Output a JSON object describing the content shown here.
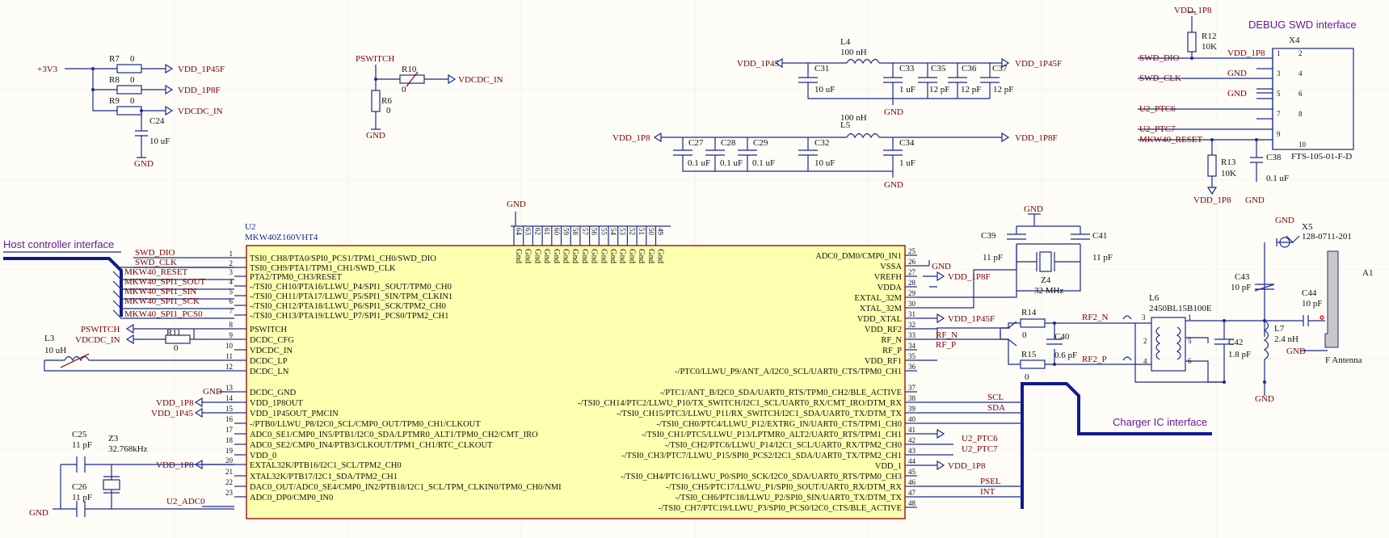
{
  "sections": {
    "host": "Host controller interface",
    "debug": "DEBUG SWD interface",
    "charger": "Charger IC interface"
  },
  "power": {
    "p3v3": "+3V3",
    "vdd1p45f_a": "VDD_1P45F",
    "vdd1p8f_a": "VDD_1P8F",
    "vdcdcin_a": "VDCDC_IN",
    "vdcdcin_b": "VDCDC_IN",
    "vdd1p45_l4": "VDD_1P45",
    "vdd1p45f_l4": "VDD_1P45F",
    "vdd1p8_l5": "VDD_1P8",
    "vdd1p8f_l5": "VDD_1P8F",
    "vdd1p8_swd": "VDD_1P8",
    "vdd1p8_r13": "VDD_1P8",
    "vdd1p8f_vrefh": "VDD_1P8F",
    "vdd1p45f_xtal": "VDD_1P45F",
    "vdd1p8_p14": "VDD_1P8",
    "vdd1p45_p15": "VDD_1P45",
    "vdd1p8_p20": "VDD_1P8",
    "vdd1p8_p44": "VDD_1P8",
    "pswitch": "PSWITCH",
    "pswitch_out": "PSWITCH"
  },
  "gnd": [
    "GND",
    "GND",
    "GND",
    "GND",
    "GND",
    "GND",
    "GND",
    "GND",
    "GND",
    "GND",
    "GND",
    "GND",
    "GND",
    "GND",
    "GND",
    "GND"
  ],
  "components": {
    "r7": "R7",
    "r7v": "0",
    "r8": "R8",
    "r8v": "0",
    "r9": "R9",
    "r9v": "0",
    "c24": "C24",
    "c24v": "10 uF",
    "r10": "R10",
    "r10v": "0",
    "r6": "R6",
    "r6v": "0",
    "l4": "L4",
    "l4v": "100 nH",
    "l5": "L5",
    "l5v": "100 nH",
    "c31": "C31",
    "c31v": "10 uF",
    "c33": "C33",
    "c33v": "1 uF",
    "c35": "C35",
    "c35v": "12 pF",
    "c36": "C36",
    "c36v": "12 pF",
    "c37": "C37",
    "c37v": "12 pF",
    "c27": "C27",
    "c27v": "0.1 uF",
    "c28": "C28",
    "c28v": "0.1 uF",
    "c29": "C29",
    "c29v": "0.1 uF",
    "c32": "C32",
    "c32v": "10 uF",
    "c34": "C34",
    "c34v": "1 uF",
    "r12": "R12",
    "r12v": "10K",
    "r13": "R13",
    "r13v": "10K",
    "c38": "C38",
    "c38v": "0.1 uF",
    "x4": "X4",
    "x4part": "FTS-105-01-F-D",
    "u2": "U2",
    "u2part": "MKW40Z160VHT4",
    "c39": "C39",
    "c39v": "11 pF",
    "c41": "C41",
    "c41v": "11 pF",
    "z4": "Z4",
    "z4v": "32 MHz",
    "r14": "R14",
    "r14v": "0",
    "r15": "R15",
    "r15v": "0",
    "c40": "C40",
    "c40v": "0.6 pF",
    "l6": "L6",
    "l6v": "2450BL15B100E",
    "c42": "C42",
    "c42v": "1.8 pF",
    "l7": "L7",
    "l7v": "2.4 nH",
    "c43": "C43",
    "c43v": "10 pF",
    "c44": "C44",
    "c44v": "10 pF",
    "x5": "X5",
    "x5part": "128-0711-201",
    "a1": "A1",
    "a1v": "F Antenna",
    "l3": "L3",
    "l3v": "10 uH",
    "r11": "R11",
    "r11v": "0",
    "c25": "C25",
    "c25v": "11 pF",
    "c26": "C26",
    "c26v": "11 pF",
    "z3": "Z3",
    "z3v": "32.768kHz"
  },
  "nets": {
    "swd_dio": "SWD_DIO",
    "swd_clk": "SWD_CLK",
    "mkw_reset": "MKW40_RESET",
    "spi_sout": "MKW40_SPI1_SOUT",
    "spi_sin": "MKW40_SPI1_SIN",
    "spi_sck": "MKW40_SPI1_SCK",
    "spi_pcs0": "MKW40_SPI1_PCS0",
    "x4_swd_dio": "SWD_DIO",
    "x4_swd_clk": "SWD_CLK",
    "x4_ptc6": "U2_PTC6",
    "x4_ptc7": "U2_PTC7",
    "x4_reset": "MKW40_RESET",
    "rf_n": "RF_N",
    "rf_p": "RF_P",
    "rf2_n": "RF2_N",
    "rf2_p": "RF2_P",
    "scl": "SCL",
    "sda": "SDA",
    "u2_ptc6": "U2_PTC6",
    "u2_ptc7": "U2_PTC7",
    "psel": "PSEL",
    "int": "INT",
    "u2_adc0": "U2_ADC0",
    "x4_gnd3": "GND",
    "x4_gnd5": "GND",
    "x4_vdd": "VDD_1P8"
  },
  "x4_pins": [
    "1",
    "2",
    "3",
    "4",
    "5",
    "6",
    "7",
    "8",
    "9",
    "10"
  ],
  "l6_pins": [
    "1",
    "2",
    "3",
    "4",
    "5",
    "6"
  ],
  "u2_left": [
    {
      "n": "1",
      "t": "TSI0_CH8/PTA0/SPI0_PCS1/TPM1_CH0/SWD_DIO"
    },
    {
      "n": "2",
      "t": "TSI0_CH9/PTA1/TPM1_CH1/SWD_CLK"
    },
    {
      "n": "3",
      "t": "PTA2/TPM0_CH3/RESET"
    },
    {
      "n": "4",
      "t": "-/TSI0_CH10/PTA16/LLWU_P4/SPI1_SOUT/TPM0_CH0"
    },
    {
      "n": "5",
      "t": "-/TSI0_CH11/PTA17/LLWU_P5/SPI1_SIN/TPM_CLKIN1"
    },
    {
      "n": "6",
      "t": "-/TSI0_CH12/PTA18/LLWU_P6/SPI1_SCK/TPM2_CH0"
    },
    {
      "n": "7",
      "t": "-/TSI0_CH13/PTA19/LLWU_P7/SPI1_PCS0/TPM2_CH1"
    },
    {
      "n": "8",
      "t": "PSWITCH"
    },
    {
      "n": "9",
      "t": "DCDC_CFG"
    },
    {
      "n": "10",
      "t": "VDCDC_IN"
    },
    {
      "n": "11",
      "t": "DCDC_LP"
    },
    {
      "n": "12",
      "t": "DCDC_LN"
    },
    {
      "n": "13",
      "t": "DCDC_GND"
    },
    {
      "n": "14",
      "t": "VDD_1P8OUT"
    },
    {
      "n": "15",
      "t": "VDD_1P45OUT_PMCIN"
    },
    {
      "n": "16",
      "t": "-/PTB0/LLWU_P8/I2C0_SCL/CMP0_OUT/TPM0_CH1/CLKOUT"
    },
    {
      "n": "17",
      "t": "ADC0_SE1/CMP0_IN5/PTB1/I2C0_SDA/LPTMR0_ALT1/TPM0_CH2/CMT_IRO"
    },
    {
      "n": "18",
      "t": "ADC0_SE2/CMP0_IN4/PTB3/CLKOUT/TPM1_CH1/RTC_CLKOUT"
    },
    {
      "n": "19",
      "t": "VDD_0"
    },
    {
      "n": "20",
      "t": "EXTAL32K/PTB16/I2C1_SCL/TPM2_CH0"
    },
    {
      "n": "21",
      "t": "XTAL32K/PTB17/I2C1_SDA/TPM2_CH1"
    },
    {
      "n": "22",
      "t": "DAC0_OUT/ADC0_SE4/CMP0_IN2/PTB18/I2C1_SCL/TPM_CLKIN0/TPM0_CH0/NMI"
    },
    {
      "n": "23",
      "t": "ADC0_DP0/CMP0_IN0"
    }
  ],
  "u2_right": [
    {
      "n": "25",
      "t": "ADC0_DM0/CMP0_IN1"
    },
    {
      "n": "26",
      "t": "VSSA"
    },
    {
      "n": "27",
      "t": "VREFH"
    },
    {
      "n": "28",
      "t": "VDDA"
    },
    {
      "n": "29",
      "t": "EXTAL_32M"
    },
    {
      "n": "30",
      "t": "XTAL_32M"
    },
    {
      "n": "31",
      "t": "VDD_XTAL"
    },
    {
      "n": "32",
      "t": "VDD_RF2"
    },
    {
      "n": "33",
      "t": "RF_N"
    },
    {
      "n": "34",
      "t": "RF_P"
    },
    {
      "n": "35",
      "t": "VDD_RF1"
    },
    {
      "n": "36",
      "t": "-/PTC0/LLWU_P9/ANT_A/I2C0_SCL/UART0_CTS/TPM0_CH1"
    },
    {
      "n": "37",
      "t": "-/PTC1/ANT_B/I2C0_SDA/UART0_RTS/TPM0_CH2/BLE_ACTIVE"
    },
    {
      "n": "38",
      "t": "-/TSI0_CH14/PTC2/LLWU_P10/TX_SWITCH/I2C1_SCL/UART0_RX/CMT_IRO/DTM_RX"
    },
    {
      "n": "39",
      "t": "-/TSI0_CH15/PTC3/LLWU_P11/RX_SWITCH/I2C1_SDA/UART0_TX/DTM_TX"
    },
    {
      "n": "40",
      "t": "-/TSI0_CH0/PTC4/LLWU_P12/EXTRG_IN/UART0_CTS/TPM1_CH0"
    },
    {
      "n": "41",
      "t": "-/TSI0_CH1/PTC5/LLWU_P13/LPTMR0_ALT2/UART0_RTS/TPM1_CH1"
    },
    {
      "n": "42",
      "t": "-/TSI0_CH2/PTC6/LLWU_P14/I2C1_SCL/UART0_RX/TPM2_CH0"
    },
    {
      "n": "43",
      "t": "-/TSI0_CH3/PTC7/LLWU_P15/SPI0_PCS2/I2C1_SDA/UART0_TX/TPM2_CH1"
    },
    {
      "n": "44",
      "t": "VDD_1"
    },
    {
      "n": "45",
      "t": "-/TSI0_CH4/PTC16/LLWU_P0/SPI0_SCK/I2C0_SDA/UART0_RTS/TPM0_CH3"
    },
    {
      "n": "46",
      "t": "-/TSI0_CH5/PTC17/LLWU_P1/SPI0_SOUT/UART0_RX/DTM_RX"
    },
    {
      "n": "47",
      "t": "-/TSI0_CH6/PTC18/LLWU_P2/SPI0_SIN/UART0_TX/DTM_TX"
    },
    {
      "n": "48",
      "t": "-/TSI0_CH7/PTC19/LLWU_P3/SPI0_PCS0/I2C0_CTS/BLE_ACTIVE"
    }
  ],
  "u2_top": [
    {
      "n": "64",
      "t": "Gnd"
    },
    {
      "n": "63",
      "t": "Gnd"
    },
    {
      "n": "62",
      "t": "Gnd"
    },
    {
      "n": "61",
      "t": "Gnd"
    },
    {
      "n": "60",
      "t": "Gnd"
    },
    {
      "n": "59",
      "t": "Gnd"
    },
    {
      "n": "58",
      "t": "Gnd"
    },
    {
      "n": "57",
      "t": "Gnd"
    },
    {
      "n": "56",
      "t": "Gnd"
    },
    {
      "n": "55",
      "t": "Gnd"
    },
    {
      "n": "54",
      "t": "Gnd"
    },
    {
      "n": "53",
      "t": "Gnd"
    },
    {
      "n": "52",
      "t": "Gnd"
    },
    {
      "n": "51",
      "t": "Gnd"
    },
    {
      "n": "50",
      "t": "Gnd"
    },
    {
      "n": "49",
      "t": "Gnd"
    }
  ]
}
